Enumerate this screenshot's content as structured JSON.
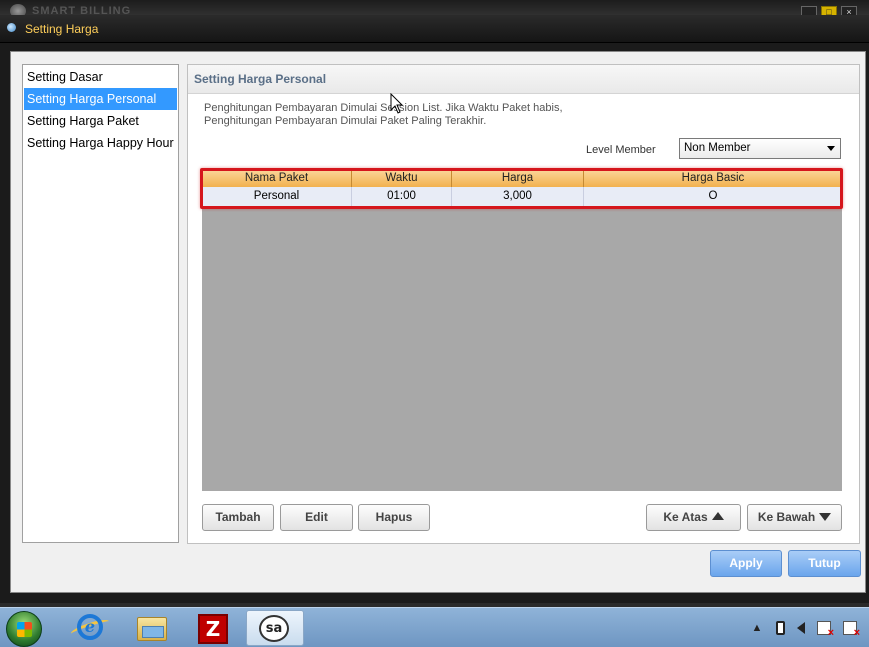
{
  "background_app": {
    "title": "SMART BILLING"
  },
  "dialog": {
    "title": "Setting Harga"
  },
  "sidebar": {
    "items": [
      {
        "label": "Setting Dasar",
        "selected": false
      },
      {
        "label": "Setting Harga Personal",
        "selected": true
      },
      {
        "label": "Setting Harga Paket",
        "selected": false
      },
      {
        "label": "Setting Harga Happy Hour",
        "selected": false
      }
    ]
  },
  "panel": {
    "title": "Setting Harga Personal",
    "description_line1": "Penghitungan Pembayaran Dimulai Session List. Jika Waktu Paket habis,",
    "description_line2": "Penghitungan Pembayaran Dimulai Paket Paling Terakhir.",
    "level_member_label": "Level Member",
    "level_member_value": "Non Member"
  },
  "table": {
    "columns": [
      "Nama Paket",
      "Waktu",
      "Harga",
      "Harga Basic"
    ],
    "rows": [
      [
        "Personal",
        "01:00",
        "3,000",
        "O"
      ]
    ]
  },
  "buttons": {
    "tambah": "Tambah",
    "edit": "Edit",
    "hapus": "Hapus",
    "ke_atas": "Ke Atas",
    "ke_bawah": "Ke Bawah",
    "apply": "Apply",
    "tutup": "Tutup"
  },
  "taskbar": {
    "filezilla_glyph": "Z",
    "smartbilling_glyph": "sa",
    "tray_up_glyph": "▲"
  },
  "colors": {
    "selection": "#3399ff",
    "highlight_box": "#d5161c",
    "header_orange": "#f2b14e",
    "title_yellow": "#ffcf5a"
  }
}
